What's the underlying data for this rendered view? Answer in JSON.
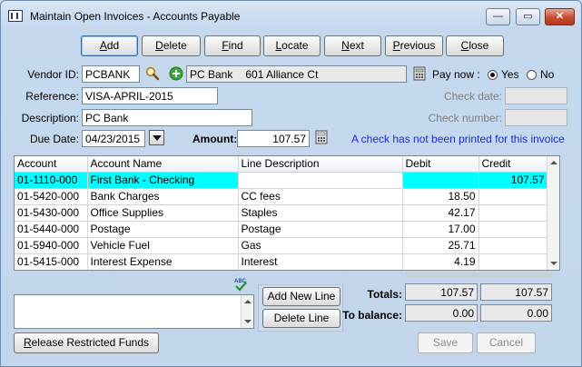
{
  "window": {
    "title": "Maintain Open Invoices - Accounts Payable",
    "controls": {
      "minimize": "—",
      "maximize": "▭",
      "close": "✕"
    }
  },
  "toolbar": {
    "add": "Add",
    "delete": "Delete",
    "find": "Find",
    "locate": "Locate",
    "next": "Next",
    "previous": "Previous",
    "close": "Close"
  },
  "form": {
    "vendor_id_label": "Vendor ID:",
    "vendor_id": "PCBANK",
    "vendor_name": "PC Bank",
    "vendor_address": "601 Alliance Ct",
    "reference_label": "Reference:",
    "reference": "VISA-APRIL-2015",
    "description_label": "Description:",
    "description": "PC Bank",
    "due_date_label": "Due Date:",
    "due_date": "04/23/2015",
    "amount_label": "Amount:",
    "amount": "107.57",
    "pay_now_label": "Pay now :",
    "yes_label": "Yes",
    "no_label": "No",
    "pay_now_selected": "Yes",
    "check_date_label": "Check date:",
    "check_date": "",
    "check_number_label": "Check number:",
    "check_number": "",
    "notice": "A check has not been printed for this invoice"
  },
  "grid": {
    "columns": [
      "Account",
      "Account Name",
      "Line Description",
      "Debit",
      "Credit"
    ],
    "rows": [
      {
        "account": "01-1110-000",
        "name": "First Bank - Checking",
        "desc": "",
        "debit": "",
        "credit": "107.57"
      },
      {
        "account": "01-5420-000",
        "name": "Bank Charges",
        "desc": "CC fees",
        "debit": "18.50",
        "credit": ""
      },
      {
        "account": "01-5430-000",
        "name": "Office Supplies",
        "desc": "Staples",
        "debit": "42.17",
        "credit": ""
      },
      {
        "account": "01-5440-000",
        "name": "Postage",
        "desc": "Postage",
        "debit": "17.00",
        "credit": ""
      },
      {
        "account": "01-5940-000",
        "name": "Vehicle Fuel",
        "desc": "Gas",
        "debit": "25.71",
        "credit": ""
      },
      {
        "account": "01-5415-000",
        "name": "Interest Expense",
        "desc": "Interest",
        "debit": "4.19",
        "credit": ""
      }
    ]
  },
  "lines": {
    "add_new_line": "Add New Line",
    "delete_line": "Delete Line"
  },
  "totals": {
    "totals_label": "Totals:",
    "debit_total": "107.57",
    "credit_total": "107.57",
    "to_balance_label": "To balance:",
    "debit_balance": "0.00",
    "credit_balance": "0.00"
  },
  "footer": {
    "release_funds": "Release Restricted Funds",
    "save": "Save",
    "cancel": "Cancel"
  }
}
